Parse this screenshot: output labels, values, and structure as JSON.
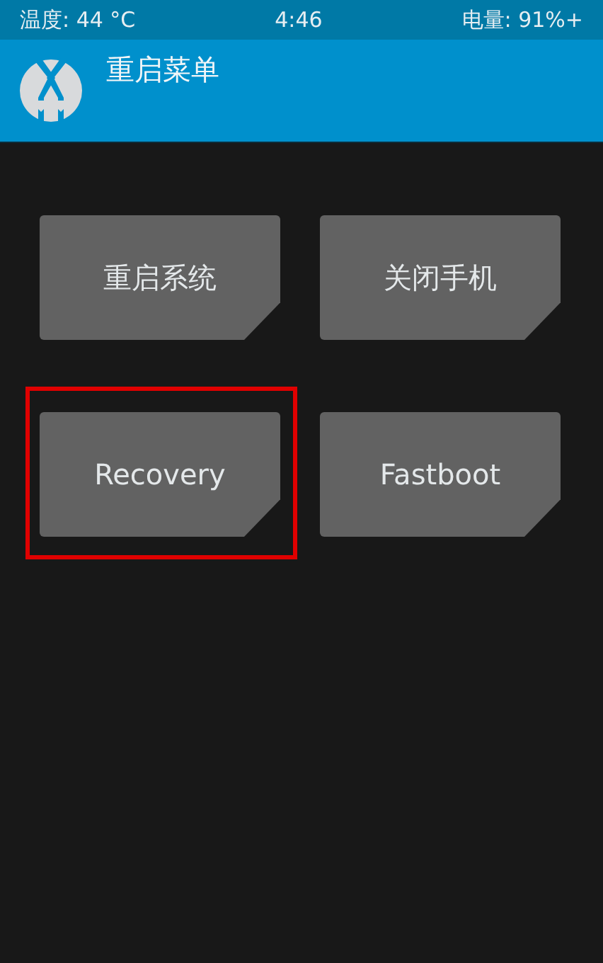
{
  "status_bar": {
    "temperature": "温度: 44 °C",
    "time": "4:46",
    "battery": "电量: 91%+"
  },
  "header": {
    "title": "重启菜单"
  },
  "buttons": [
    {
      "label": "重启系统",
      "highlighted": false
    },
    {
      "label": "关闭手机",
      "highlighted": false
    },
    {
      "label": "Recovery",
      "highlighted": true
    },
    {
      "label": "Fastboot",
      "highlighted": false
    }
  ]
}
